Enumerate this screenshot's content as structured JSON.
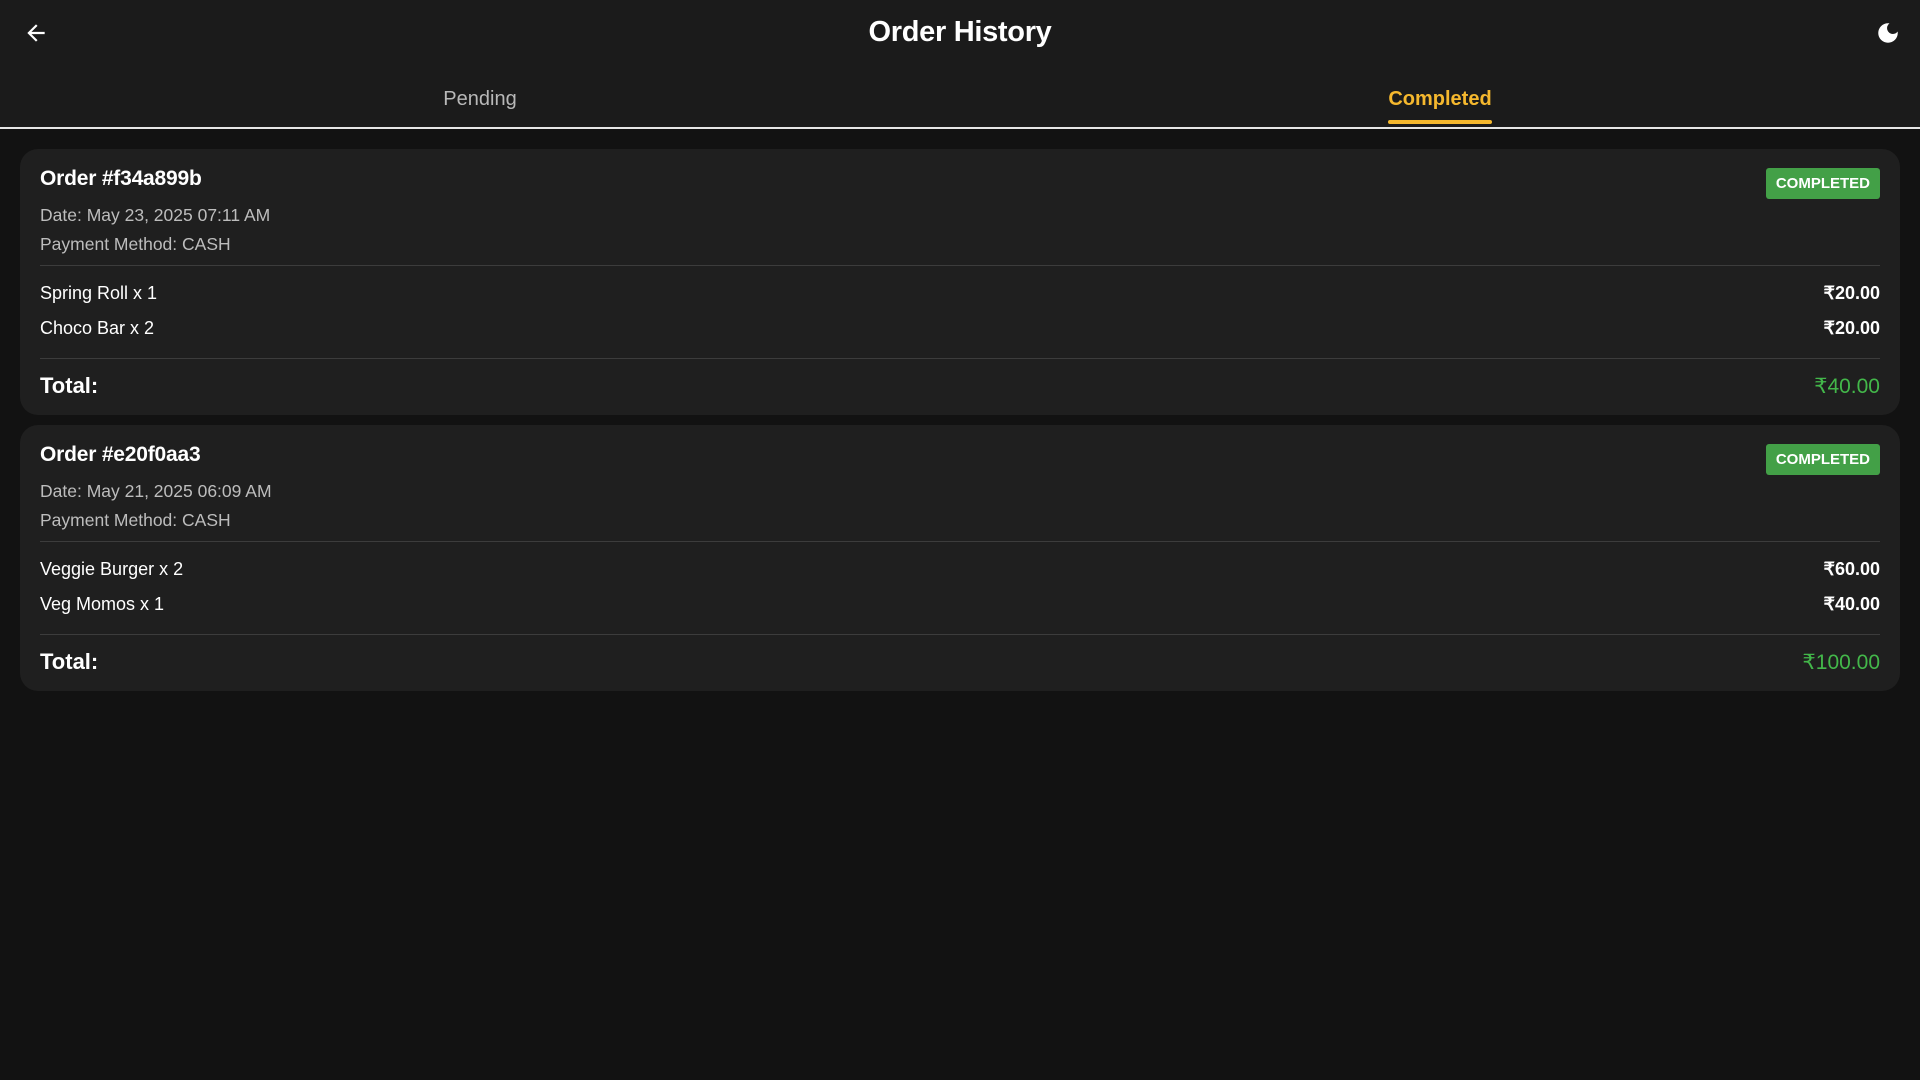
{
  "header": {
    "title": "Order History",
    "back_icon": "arrow-left-icon",
    "theme_icon": "moon-icon"
  },
  "tabs": [
    {
      "label": "Pending",
      "active": false
    },
    {
      "label": "Completed",
      "active": true
    }
  ],
  "colors": {
    "accent": "#f5b82e",
    "status_completed": "#43a047",
    "total_green": "#43b74a",
    "background": "#121212",
    "card": "#1f1f1f"
  },
  "orders": [
    {
      "id": "Order #f34a899b",
      "date": "Date: May 23, 2025 07:11 AM",
      "payment": "Payment Method: CASH",
      "status": "COMPLETED",
      "items": [
        {
          "name": "Spring Roll x 1",
          "price": "₹20.00"
        },
        {
          "name": "Choco Bar x 2",
          "price": "₹20.00"
        }
      ],
      "total_label": "Total:",
      "total": "₹40.00"
    },
    {
      "id": "Order #e20f0aa3",
      "date": "Date: May 21, 2025 06:09 AM",
      "payment": "Payment Method: CASH",
      "status": "COMPLETED",
      "items": [
        {
          "name": "Veggie Burger x 2",
          "price": "₹60.00"
        },
        {
          "name": "Veg Momos x 1",
          "price": "₹40.00"
        }
      ],
      "total_label": "Total:",
      "total": "₹100.00"
    }
  ]
}
